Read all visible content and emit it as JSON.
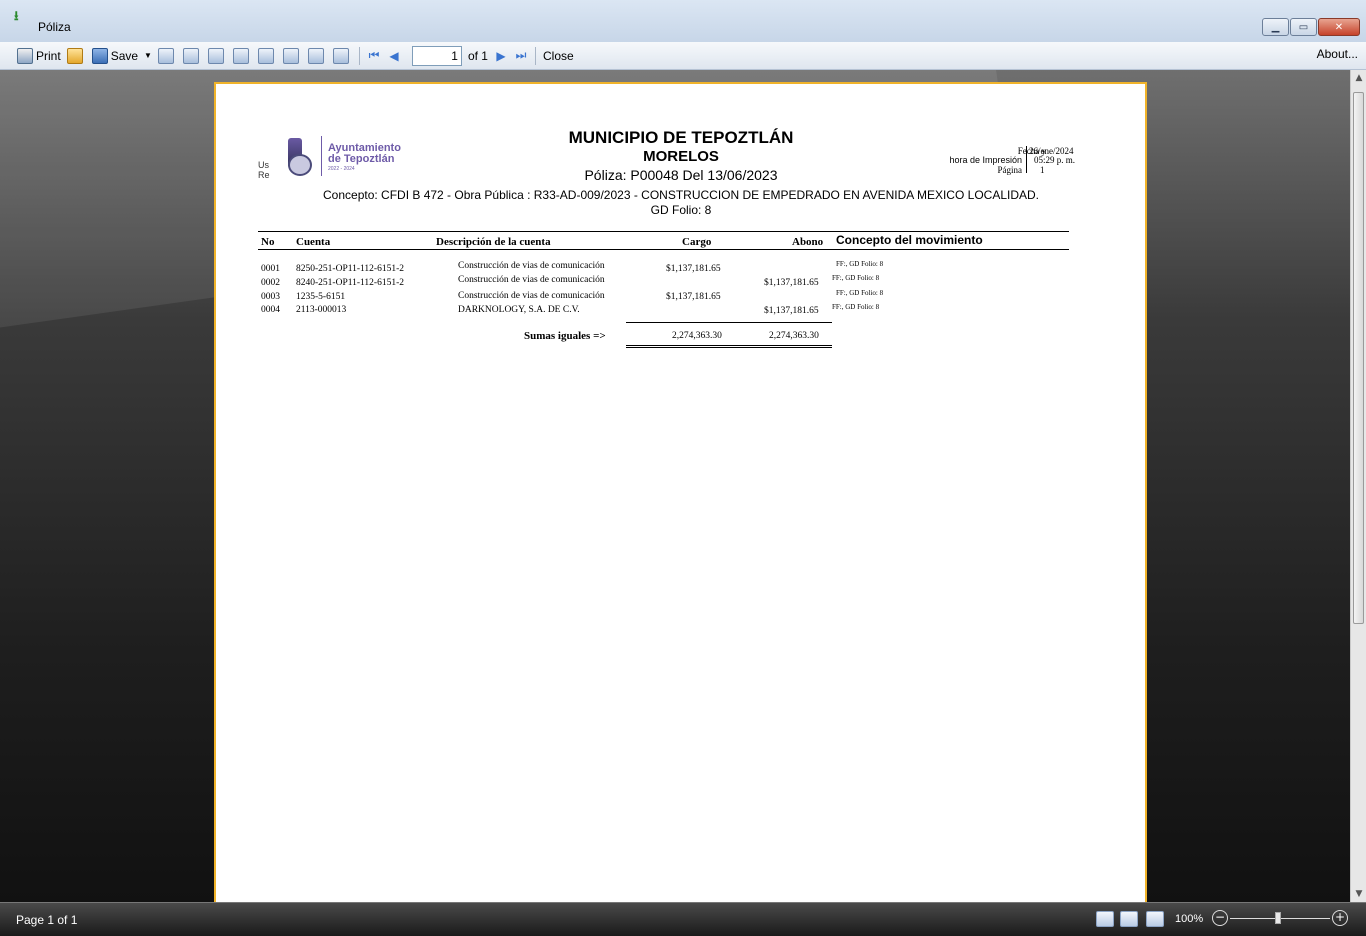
{
  "window": {
    "title": "Póliza",
    "icon": "app-icon"
  },
  "toolbar": {
    "print_label": "Print",
    "save_label": "Save",
    "page_value": "1",
    "page_of": "of 1",
    "close_label": "Close",
    "about_label": "About..."
  },
  "report": {
    "logo_line1": "Ayuntamiento",
    "logo_line2": "de Tepoztlán",
    "logo_line3": "2022 - 2024",
    "cut_text1": "Us",
    "cut_text2": "Re",
    "title": "MUNICIPIO DE TEPOZTLÁN",
    "subtitle": "MORELOS",
    "poliza": "Póliza:  P00048  Del 13/06/2023",
    "concepto": "Concepto: CFDI B 472 - Obra Pública : R33-AD-009/2023 - CONSTRUCCION DE EMPEDRADO EN AVENIDA MEXICO LOCALIDAD.",
    "gd_folio": "GD Folio: 8",
    "meta": {
      "label1": "Fecha y",
      "label2": "hora de Impresión",
      "label3": "Página",
      "value1": "26/ene/2024",
      "value2": "05:29 p. m.",
      "value3": "1"
    },
    "columns": {
      "no": "No",
      "cuenta": "Cuenta",
      "descripcion": "Descripción de la cuenta",
      "cargo": "Cargo",
      "abono": "Abono",
      "concepto": "Concepto del movimiento"
    },
    "rows": [
      {
        "no": "0001",
        "cuenta": "8250-251-OP11-112-6151-2",
        "descripcion": "Construcción de vias de comunicación",
        "cargo": "$1,137,181.65",
        "abono": "",
        "concepto": "FF:, GD Folio: 8"
      },
      {
        "no": "0002",
        "cuenta": "8240-251-OP11-112-6151-2",
        "descripcion": "Construcción de vias de comunicación",
        "cargo": "",
        "abono": "$1,137,181.65",
        "concepto": "FF:, GD Folio: 8"
      },
      {
        "no": "0003",
        "cuenta": "1235-5-6151",
        "descripcion": "Construcción de vias de comunicación",
        "cargo": "$1,137,181.65",
        "abono": "",
        "concepto": "FF:, GD Folio: 8"
      },
      {
        "no": "0004",
        "cuenta": "2113-000013",
        "descripcion": "DARKNOLOGY, S.A. DE C.V.",
        "cargo": "",
        "abono": "$1,137,181.65",
        "concepto": "FF:, GD Folio: 8"
      }
    ],
    "sumas_label": "Sumas iguales =>",
    "sum_cargo": "2,274,363.30",
    "sum_abono": "2,274,363.30"
  },
  "statusbar": {
    "page_info": "Page 1 of 1",
    "zoom": "100%"
  }
}
